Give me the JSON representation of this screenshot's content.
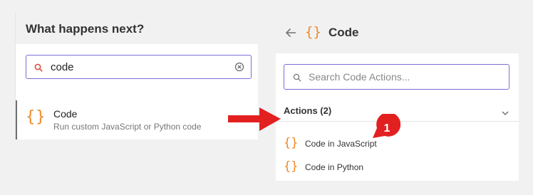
{
  "left": {
    "header": "What happens next?",
    "search_value": "code",
    "result": {
      "icon": "{}",
      "title": "Code",
      "description": "Run custom JavaScript or Python code"
    }
  },
  "right": {
    "icon": "{}",
    "title": "Code",
    "search_placeholder": "Search Code Actions...",
    "section_label": "Actions (2)",
    "actions": [
      {
        "icon": "{}",
        "label": "Code in JavaScript"
      },
      {
        "icon": "{}",
        "label": "Code in Python"
      }
    ]
  },
  "annotation": {
    "badge_number": "1"
  },
  "colors": {
    "accent": "#f08a24",
    "focus_border": "#7b6fd6",
    "annotation_red": "#e32020"
  },
  "icons": [
    "search-icon",
    "clear-icon",
    "back-arrow-icon",
    "chevron-down-icon",
    "code-braces-icon"
  ]
}
